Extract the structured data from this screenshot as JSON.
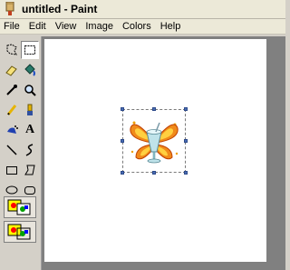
{
  "window": {
    "title": "untitled - Paint",
    "icon": "paint-palette-icon"
  },
  "menubar": {
    "items": [
      "File",
      "Edit",
      "View",
      "Image",
      "Colors",
      "Help"
    ]
  },
  "toolbox": {
    "tools": [
      {
        "name": "free-form-select-icon"
      },
      {
        "name": "rectangle-select-icon",
        "selected": true
      },
      {
        "name": "eraser-icon"
      },
      {
        "name": "fill-bucket-icon"
      },
      {
        "name": "color-picker-icon"
      },
      {
        "name": "magnifier-icon"
      },
      {
        "name": "pencil-icon"
      },
      {
        "name": "brush-icon"
      },
      {
        "name": "airbrush-icon"
      },
      {
        "name": "text-icon",
        "label": "A"
      },
      {
        "name": "line-icon"
      },
      {
        "name": "curve-icon"
      },
      {
        "name": "rectangle-icon"
      },
      {
        "name": "polygon-icon"
      },
      {
        "name": "ellipse-icon"
      },
      {
        "name": "rounded-rectangle-icon"
      }
    ],
    "options": [
      "opaque-selection-option",
      "transparent-selection-option"
    ]
  },
  "canvas": {
    "background": "#ffffff",
    "image": "butterfly-parfait-clip-art"
  }
}
